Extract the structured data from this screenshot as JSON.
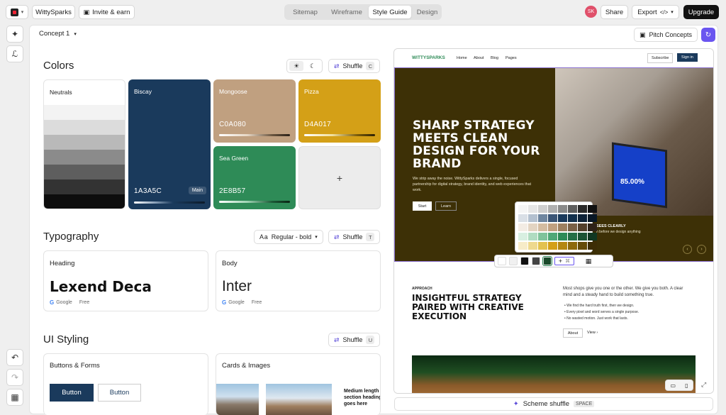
{
  "topbar": {
    "logo_icon": "cube-logo-icon",
    "workspace": "WittySparks",
    "invite": "Invite & earn",
    "tabs": [
      {
        "label": "Sitemap",
        "active": false
      },
      {
        "label": "Wireframe",
        "active": false
      },
      {
        "label": "Style Guide",
        "active": true
      },
      {
        "label": "Design",
        "active": false
      }
    ],
    "avatar": "SK",
    "share": "Share",
    "export": "Export",
    "upgrade": "Upgrade"
  },
  "subbar": {
    "concept": "Concept 1",
    "pitch": "Pitch Concepts"
  },
  "colors": {
    "title": "Colors",
    "shuffle": "Shuffle",
    "shuffle_key": "C",
    "neutrals_label": "Neutrals",
    "neutral_stripes": [
      "#f3f3f3",
      "#dcdcdc",
      "#b9b9b9",
      "#8b8b8b",
      "#5e5e5e",
      "#333333",
      "#0d0d0d"
    ],
    "cards": [
      {
        "name": "Biscay",
        "hex": "1A3A5C",
        "color": "#1a3a5c",
        "badge": "Main"
      },
      {
        "name": "Mongoose",
        "hex": "C0A080",
        "color": "#c0a080"
      },
      {
        "name": "Pizza",
        "hex": "D4A017",
        "color": "#d4a017"
      },
      {
        "name": "Sea Green",
        "hex": "2E8B57",
        "color": "#2e8b57"
      }
    ],
    "add": "+"
  },
  "typography": {
    "title": "Typography",
    "weight": "Regular - bold",
    "shuffle": "Shuffle",
    "shuffle_key": "T",
    "heading": {
      "label": "Heading",
      "font": "Lexend Deca",
      "source": "Google",
      "price": "Free"
    },
    "body": {
      "label": "Body",
      "font": "Inter",
      "source": "Google",
      "price": "Free"
    }
  },
  "ui_styling": {
    "title": "UI Styling",
    "shuffle": "Shuffle",
    "shuffle_key": "U",
    "buttons_label": "Buttons & Forms",
    "button_primary": "Button",
    "button_secondary": "Button",
    "cards_label": "Cards & Images",
    "card_text": "Medium length section heading goes here"
  },
  "preview": {
    "brand": "WITTYSPARKS",
    "nav": [
      "Home",
      "About",
      "Blog",
      "Pages"
    ],
    "subscribe": "Subscribe",
    "signin": "Sign in",
    "hero_title": "SHARP STRATEGY MEETS CLEAN DESIGN FOR YOUR BRAND",
    "hero_text": "We strip away the noise. WittySparks delivers a single, focused partnership for digital strategy, brand identity, and web experiences that work.",
    "btn_start": "Start",
    "btn_learn": "Learn",
    "screen_stat": "85.00%",
    "caption_title": "SEES CLEARLY",
    "caption_text": "h before we design anything",
    "approach_label": "APPROACH",
    "approach_title": "INSIGHTFUL STRATEGY PAIRED WITH CREATIVE EXECUTION",
    "approach_text": "Most shops give you one or the other. We give you both. A clear mind and a steady hand to build something true.",
    "bullets": [
      "We find the hard truth first, then we design.",
      "Every pixel and word serves a single purpose.",
      "No wasted motion. Just work that lasts."
    ],
    "about": "About",
    "view": "View"
  },
  "popover_rows": [
    [
      "#f5f5f5",
      "#e6e6e6",
      "#cfcfcf",
      "#b0b0b0",
      "#8a8a8a",
      "#5e5e5e",
      "#2a2a2a",
      "#111111"
    ],
    [
      "#d9dfe6",
      "#b3c0cf",
      "#6f86a0",
      "#3c5677",
      "#1a3a5c",
      "#12304d",
      "#0d2238",
      "#081726"
    ],
    [
      "#f3ece4",
      "#e3d4c2",
      "#d4bca1",
      "#c0a080",
      "#9e8060",
      "#7a6046",
      "#54402c",
      "#2e2218"
    ],
    [
      "#d8efe1",
      "#b0dcc1",
      "#7fc39b",
      "#4fa877",
      "#2e8b57",
      "#256f46",
      "#1b5334",
      "#103722"
    ],
    [
      "#f7ecc8",
      "#eed98e",
      "#e3c24f",
      "#d4a017",
      "#b48711",
      "#8d690c",
      "#654b08",
      "#3d2d05"
    ]
  ],
  "swatch_bar": [
    "#ffffff",
    "#f0f0f0",
    "#111111",
    "#444444",
    "#1a4a2a"
  ],
  "scheme": {
    "label": "Scheme shuffle",
    "key": "SPACE"
  }
}
